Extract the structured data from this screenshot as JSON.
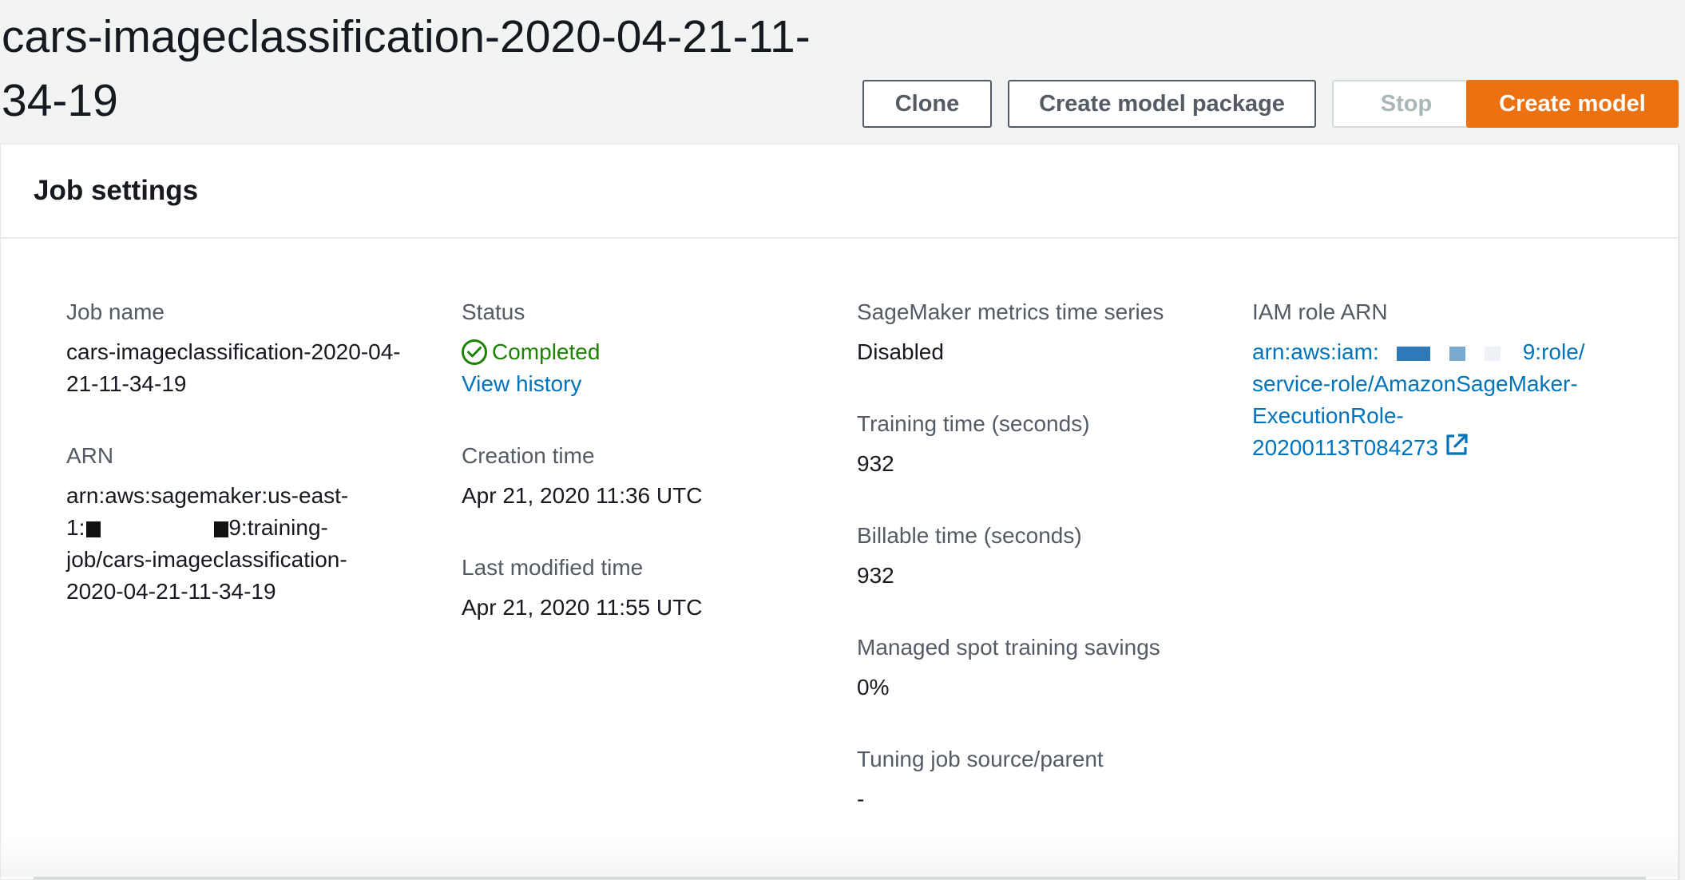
{
  "page": {
    "title": "cars-imageclassification-2020-04-21-11-34-19"
  },
  "actions": {
    "clone": "Clone",
    "create_model_package": "Create model package",
    "stop": "Stop",
    "create_model": "Create model"
  },
  "job_settings": {
    "title": "Job settings",
    "job_name": {
      "label": "Job name",
      "line1": "cars-imageclassification-2020-04-",
      "line2": "21-11-34-19"
    },
    "arn": {
      "label": "ARN",
      "line1": "arn:aws:sagemaker:us-east-",
      "line2_prefix": "1:",
      "line2_suffix": "9:training-",
      "line3": "job/cars-imageclassification-",
      "line4": "2020-04-21-11-34-19"
    },
    "status": {
      "label": "Status",
      "value": "Completed",
      "icon": "check-circle-icon",
      "color": "#1d8102",
      "history_link": "View history"
    },
    "creation_time": {
      "label": "Creation time",
      "value": "Apr 21, 2020 11:36 UTC"
    },
    "last_modified_time": {
      "label": "Last modified time",
      "value": "Apr 21, 2020 11:55 UTC"
    },
    "metrics_time_series": {
      "label": "SageMaker metrics time series",
      "value": "Disabled"
    },
    "training_time": {
      "label": "Training time (seconds)",
      "value": "932"
    },
    "billable_time": {
      "label": "Billable time (seconds)",
      "value": "932"
    },
    "spot_savings": {
      "label": "Managed spot training savings",
      "value": "0%"
    },
    "tuning_job_source": {
      "label": "Tuning job source/parent",
      "value": "-"
    },
    "iam_role_arn": {
      "label": "IAM role ARN",
      "line1_prefix": "arn:aws:iam:",
      "line1_suffix": "9:role/",
      "line2": "service-role/AmazonSageMaker-",
      "line3": "ExecutionRole-",
      "line4": "20200113T084273",
      "icon": "external-link-icon"
    }
  },
  "colors": {
    "primary": "#ec7211",
    "link": "#0073bb",
    "success": "#1d8102",
    "background": "#f2f3f3"
  }
}
